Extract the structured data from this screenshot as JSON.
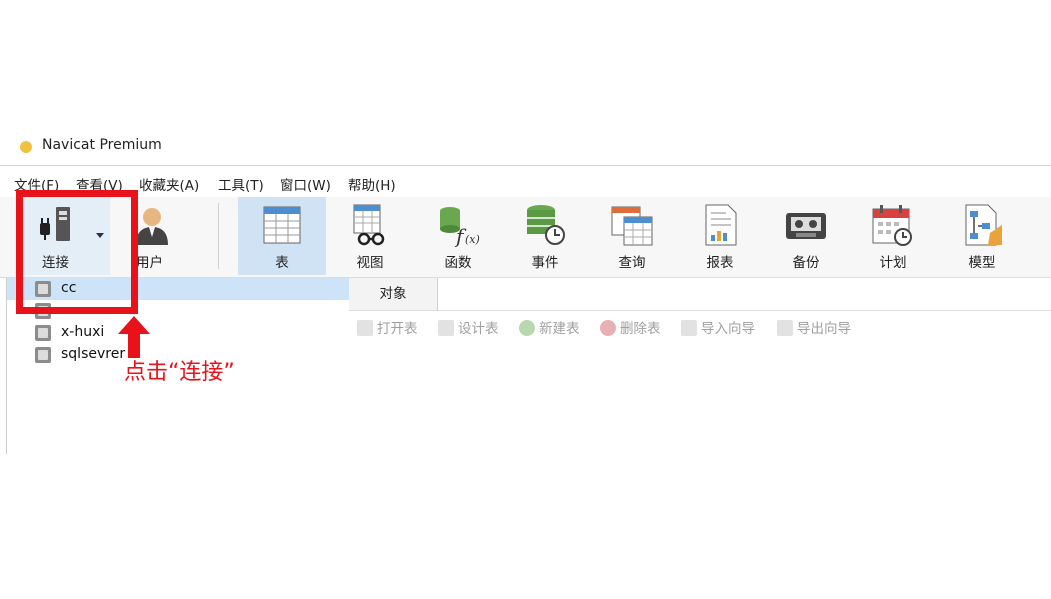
{
  "window": {
    "title": "Navicat Premium"
  },
  "menu": [
    {
      "label": "文件(F)"
    },
    {
      "label": "查看(V)"
    },
    {
      "label": "收藏夹(A)"
    },
    {
      "label": "工具(T)"
    },
    {
      "label": "窗口(W)"
    },
    {
      "label": "帮助(H)"
    }
  ],
  "toolbar": {
    "connect": "连接",
    "user": "用户",
    "table": "表",
    "view": "视图",
    "function": "函数",
    "event": "事件",
    "query": "查询",
    "report": "报表",
    "backup": "备份",
    "schedule": "计划",
    "model": "模型"
  },
  "tree": {
    "items": [
      {
        "label": "cc",
        "selected": true
      },
      {
        "label": ""
      },
      {
        "label": "x-huxi"
      },
      {
        "label": "sqlsevrer"
      }
    ]
  },
  "object_panel": {
    "tab": "对象",
    "actions": [
      {
        "label": "打开表"
      },
      {
        "label": "设计表"
      },
      {
        "label": "新建表"
      },
      {
        "label": "删除表"
      },
      {
        "label": "导入向导"
      },
      {
        "label": "导出向导"
      }
    ]
  },
  "annotation": {
    "text": "点击“连接”",
    "color": "#e8121b"
  }
}
